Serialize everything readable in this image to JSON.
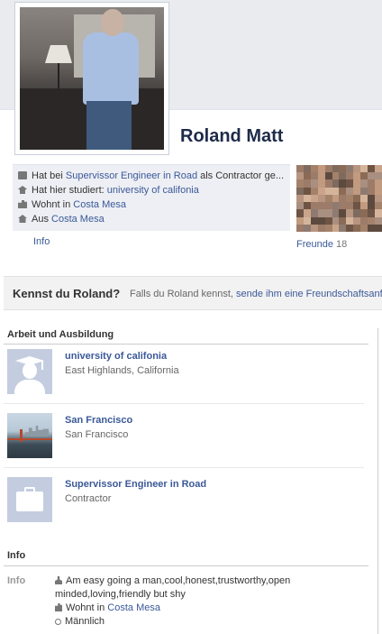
{
  "profile": {
    "name": "Roland Matt"
  },
  "about": {
    "rows": [
      {
        "prefix": "Hat bei ",
        "link": "Supervissor Engineer in Road",
        "suffix": " als Contractor ge...",
        "icon": "briefcase-icon"
      },
      {
        "prefix": "Hat hier studiert: ",
        "link": "university of califonia",
        "suffix": "",
        "icon": "graduation-cap-icon"
      },
      {
        "prefix": "Wohnt in ",
        "link": "Costa Mesa",
        "suffix": "",
        "icon": "city-icon"
      },
      {
        "prefix": "Aus ",
        "link": "Costa Mesa",
        "suffix": "",
        "icon": "home-icon"
      }
    ],
    "info_link": "Info"
  },
  "friends": {
    "label": "Freunde",
    "count": "18"
  },
  "kennst": {
    "title": "Kennst du Roland?",
    "text_prefix": "Falls du Roland kennst,",
    "text_link": "sende ihm eine Freundschaftsanfra"
  },
  "work_education": {
    "title": "Arbeit und Ausbildung",
    "entries": [
      {
        "title": "university of califonia",
        "subtitle": "East Highlands, California",
        "icon": "graduation-silhouette-icon"
      },
      {
        "title": "San Francisco",
        "subtitle": "San Francisco",
        "icon": "city-photo"
      },
      {
        "title": "Supervissor Engineer in Road",
        "subtitle": "Contractor",
        "icon": "briefcase-icon"
      }
    ]
  },
  "info_section": {
    "title": "Info",
    "label": "Info",
    "bio": "Am easy going a man,cool,honest,trustworthy,open minded,loving,friendly but shy",
    "lives_prefix": "Wohnt in ",
    "lives_link": "Costa Mesa",
    "gender": "Männlich"
  },
  "colors": {
    "link": "#3b5998",
    "name": "#1d2a4a",
    "about_bg": "#edeff4",
    "kennst_bg": "#f2f2f2"
  }
}
